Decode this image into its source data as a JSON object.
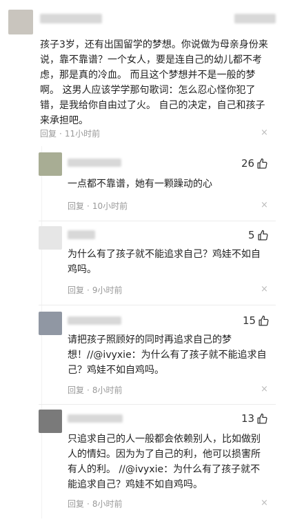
{
  "main_comment": {
    "text": "孩子3岁，还有出国留学的梦想。你说做为母亲身份来说，靠不靠谱？一个女人，要是连自己的幼儿都不考虑，那是真的冷血。 而且这个梦想并不是一般的梦啊。 这男人应该学学那句歌词：怎么忍心怪你犯了错，是我给你自由过了火。 自己的决定，自己和孩子来承担吧。",
    "reply_label": "回复",
    "time": "11小时前",
    "close_symbol": "×"
  },
  "replies": [
    {
      "likes": "26",
      "text": "一点都不靠谱，她有一颗躁动的心",
      "reply_label": "回复",
      "time": "10小时前",
      "close_symbol": "×"
    },
    {
      "likes": "5",
      "text": "为什么有了孩子就不能追求自己？鸡娃不如自鸡吗。",
      "reply_label": "回复",
      "time": "9小时前",
      "close_symbol": "×"
    },
    {
      "likes": "15",
      "text": "请把孩子照顾好的同时再追求自己的梦想！//@ivyxie：为什么有了孩子就不能追求自己？鸡娃不如自鸡吗。",
      "reply_label": "回复",
      "time": "8小时前",
      "close_symbol": "×"
    },
    {
      "likes": "13",
      "text": "只追求自己的人一般都会依赖别人，比如做别人的情妇。因为为了自己的利，他可以损害所有人的利。 //@ivyxie：为什么有了孩子就不能追求自己？鸡娃不如自鸡吗。",
      "reply_label": "回复",
      "time": "8小时前",
      "close_symbol": "×"
    }
  ],
  "colors": {
    "text": "#222222",
    "meta": "#999999",
    "avatar_1": "#c9c5be",
    "avatar_2": "#a8ad94",
    "avatar_3": "#e6e6e6",
    "avatar_4": "#9097a3",
    "avatar_5": "#7a7a7a"
  },
  "icons": {
    "like": "thumbs-up-icon",
    "close": "close-icon"
  }
}
